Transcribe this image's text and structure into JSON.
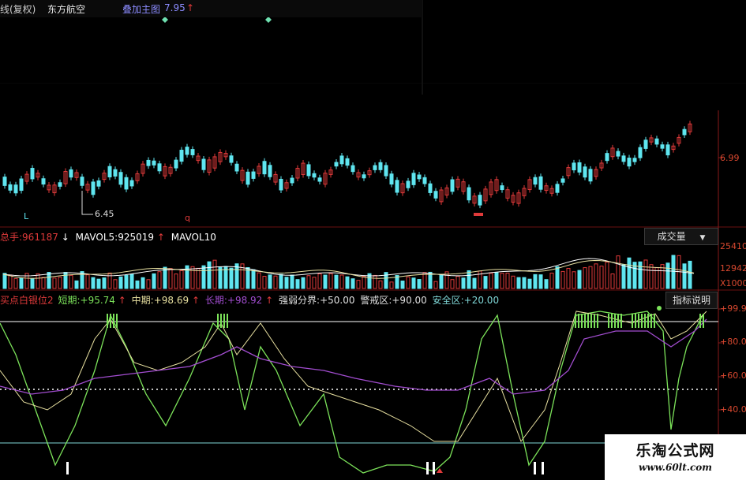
{
  "header": {
    "chart_mode": "线(复权)",
    "stock_name": "东方航空",
    "overlay_label": "叠加主图",
    "overlay_value": "7.95",
    "overlay_arrow": "↑"
  },
  "price_panel": {
    "right_axis": [
      "6.99"
    ],
    "low_marker": "6.45",
    "bottom_left_mark": "L",
    "bottom_mid_mark": "q"
  },
  "volume_panel": {
    "prefix": "总手:",
    "total": "961187",
    "total_arrow": "↓",
    "mavol5_label": "MAVOL5:",
    "mavol5_value": "925019",
    "mavol5_arrow": "↑",
    "mavol10_label": "MAVOL10",
    "selector_label": "成交量",
    "selector_caret": "▼",
    "right_axis": [
      "25410",
      "12942",
      "X1000"
    ]
  },
  "indicator_panel": {
    "name": "买点白银位2",
    "short_label": "短期:",
    "short_value": "+95.74",
    "short_arrow": "↑",
    "mid_label": "中期:",
    "mid_value": "+98.69",
    "mid_arrow": "↑",
    "long_label": "长期:",
    "long_value": "+98.92",
    "long_arrow": "↑",
    "boundary_label": "强弱分界:",
    "boundary_value": "+50.00",
    "alert_label": "警戒区:",
    "alert_value": "+90.00",
    "safe_label": "安全区:",
    "safe_value": "+20.00",
    "help_button": "指标说明",
    "right_axis": [
      "+99.99",
      "+80.00",
      "+60.00",
      "+40.00"
    ]
  },
  "watermark": {
    "title": "乐淘公式网",
    "url": "www.60lt.com"
  },
  "colors": {
    "up": "#e03a3a",
    "down": "#5fe6f0",
    "green": "#7ce35a",
    "purple": "#a24dd0",
    "yellow": "#e8e0a0",
    "white": "#ffffff",
    "cyan": "#7fd6d6"
  }
}
